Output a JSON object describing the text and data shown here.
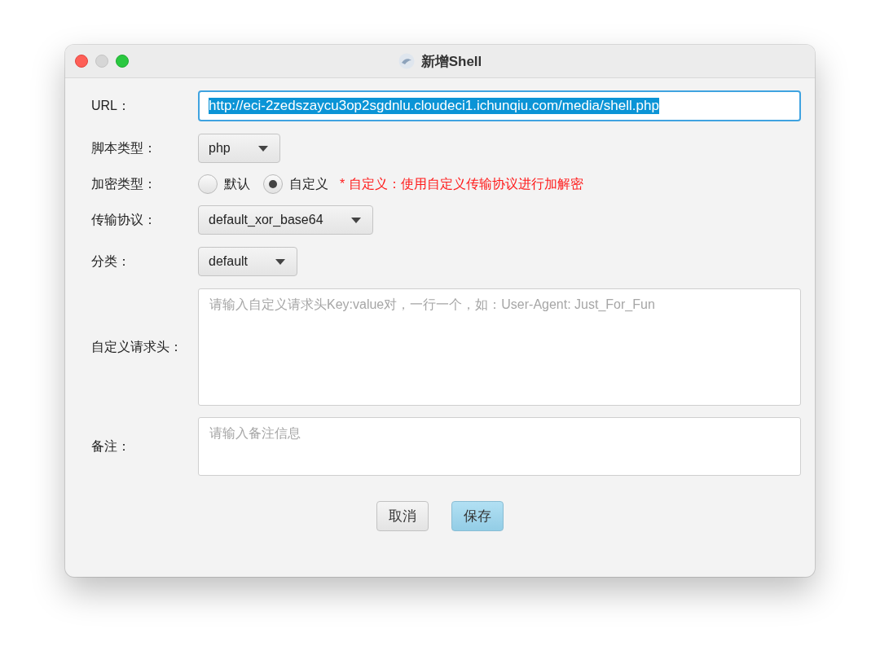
{
  "window": {
    "title": "新增Shell"
  },
  "form": {
    "url": {
      "label": "URL：",
      "value": "http://eci-2zedszaycu3op2sgdnlu.cloudeci1.ichunqiu.com/media/shell.php",
      "text_selected": true
    },
    "script_type": {
      "label": "脚本类型：",
      "value": "php"
    },
    "encryption": {
      "label": "加密类型：",
      "options": [
        {
          "label": "默认",
          "selected": false
        },
        {
          "label": "自定义",
          "selected": true
        }
      ],
      "note": "* 自定义：使用自定义传输协议进行加解密"
    },
    "transport": {
      "label": "传输协议：",
      "value": "default_xor_base64"
    },
    "category": {
      "label": "分类：",
      "value": "default"
    },
    "headers": {
      "label": "自定义请求头：",
      "placeholder": "请输入自定义请求头Key:value对，一行一个，如：User-Agent: Just_For_Fun"
    },
    "notes": {
      "label": "备注：",
      "placeholder": "请输入备注信息"
    }
  },
  "buttons": [
    {
      "label": "取消",
      "kind": "plain"
    },
    {
      "label": "保存",
      "kind": "primary"
    }
  ]
}
